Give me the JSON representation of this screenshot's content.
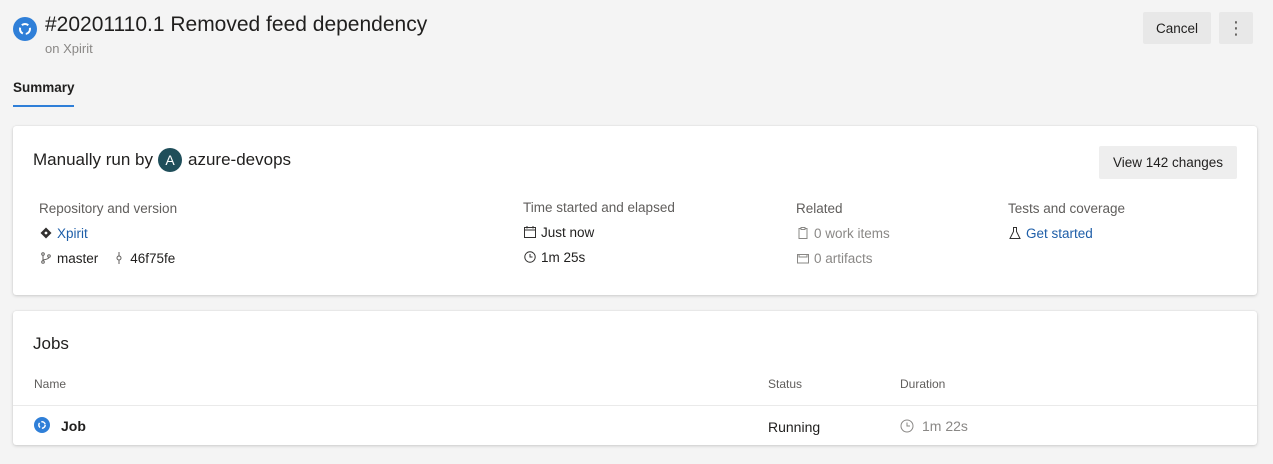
{
  "header": {
    "title": "#20201110.1 Removed feed dependency",
    "subtitle": "on Xpirit",
    "cancel_label": "Cancel",
    "more_label": "⋮",
    "status_icon": "running-icon",
    "accent": "#2f7fd8"
  },
  "tabs": [
    {
      "label": "Summary",
      "selected": true
    }
  ],
  "summary": {
    "manual_run_prefix": "Manually run by",
    "avatar_initial": "A",
    "user": "azure-devops",
    "view_changes_label": "View 142 changes",
    "repository": {
      "label": "Repository and version",
      "repo": "Xpirit",
      "branch": "master",
      "commit": "46f75fe"
    },
    "time": {
      "label": "Time started and elapsed",
      "started": "Just now",
      "elapsed": "1m 25s"
    },
    "related": {
      "label": "Related",
      "work_items": "0 work items",
      "artifacts": "0 artifacts"
    },
    "tests": {
      "label": "Tests and coverage",
      "link": "Get started"
    }
  },
  "jobs": {
    "title": "Jobs",
    "columns": {
      "name": "Name",
      "status": "Status",
      "duration": "Duration"
    },
    "rows": [
      {
        "name": "Job",
        "status": "Running",
        "duration": "1m 22s"
      }
    ]
  }
}
